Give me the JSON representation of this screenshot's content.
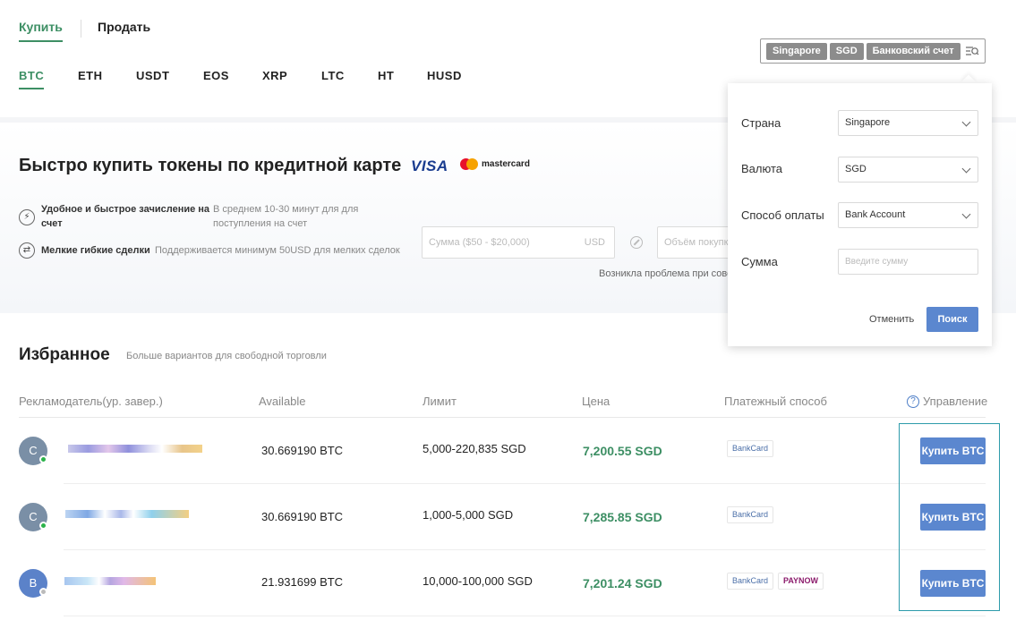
{
  "trade_tabs": [
    {
      "label": "Купить",
      "active": true
    },
    {
      "label": "Продать",
      "active": false
    }
  ],
  "coins": [
    {
      "label": "BTC",
      "active": true
    },
    {
      "label": "ETH"
    },
    {
      "label": "USDT"
    },
    {
      "label": "EOS"
    },
    {
      "label": "XRP"
    },
    {
      "label": "LTC"
    },
    {
      "label": "HT"
    },
    {
      "label": "HUSD"
    }
  ],
  "filter": {
    "chips": [
      "Singapore",
      "SGD",
      "Банковский счет"
    ]
  },
  "hero": {
    "title": "Быстро купить токены по кредитной карте",
    "visa": "VISA",
    "mastercard": "mastercard",
    "features": [
      {
        "bold": "Удобное и быстрое зачисление на счет",
        "note": "В среднем 10-30 минут для для поступления на счет"
      },
      {
        "bold": "Мелкие гибкие сделки",
        "note": "Поддерживается минимум 50USD для мелких сделок"
      }
    ],
    "amount_placeholder": "Сумма ($50 - $20,000)",
    "amount_unit": "USD",
    "volume_placeholder": "Объём покупк",
    "problem_text": "Возникла проблема при сове"
  },
  "favorites": {
    "title": "Избранное",
    "subtitle": "Больше вариантов для свободной торговли",
    "headers": {
      "advertiser": "Рекламодатель(ур. завер.)",
      "available": "Available",
      "limit": "Лимит",
      "price": "Цена",
      "payment": "Платежный способ",
      "action": "Управление"
    },
    "rows": [
      {
        "initial": "C",
        "online": true,
        "available": "30.669190 BTC",
        "limit": "5,000-220,835 SGD",
        "price": "7,200.55 SGD",
        "payments": [
          "BankCard"
        ],
        "button": "Купить BTC"
      },
      {
        "initial": "C",
        "online": true,
        "available": "30.669190 BTC",
        "limit": "1,000-5,000 SGD",
        "price": "7,285.85 SGD",
        "payments": [
          "BankCard"
        ],
        "button": "Купить BTC"
      },
      {
        "initial": "B",
        "online": false,
        "available": "21.931699 BTC",
        "limit": "10,000-100,000 SGD",
        "price": "7,201.24 SGD",
        "payments": [
          "BankCard",
          "PAYNOW"
        ],
        "button": "Купить BTC"
      }
    ]
  },
  "panel": {
    "country_label": "Страна",
    "country_value": "Singapore",
    "currency_label": "Валюта",
    "currency_value": "SGD",
    "payment_label": "Способ оплаты",
    "payment_value": "Bank Account",
    "amount_label": "Сумма",
    "amount_placeholder": "Введите сумму",
    "cancel": "Отменить",
    "search": "Поиск"
  },
  "colors": {
    "accent_green": "#3d8f64",
    "button_blue": "#5b87cf",
    "chip_grey": "#8c8c8c"
  }
}
